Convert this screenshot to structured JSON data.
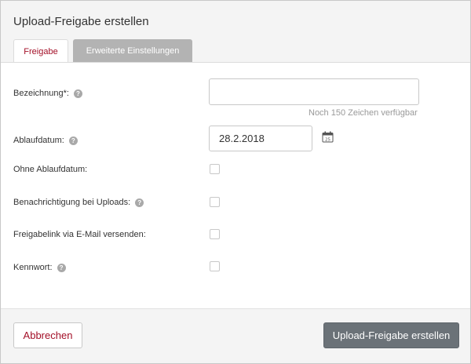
{
  "dialog": {
    "title": "Upload-Freigabe erstellen"
  },
  "tabs": [
    {
      "label": "Freigabe",
      "active": true
    },
    {
      "label": "Erweiterte Einstellungen",
      "active": false
    }
  ],
  "form": {
    "bezeichnung": {
      "label": "Bezeichnung*:",
      "value": "",
      "hint": "Noch 150 Zeichen verfügbar"
    },
    "ablaufdatum": {
      "label": "Ablaufdatum:",
      "value": "28.2.2018",
      "calendar_day": "25"
    },
    "ohne_ablaufdatum": {
      "label": "Ohne Ablaufdatum:",
      "checked": false
    },
    "benachrichtigung": {
      "label": "Benachrichtigung bei Uploads:",
      "checked": false
    },
    "email_versenden": {
      "label": "Freigabelink via E-Mail versenden:",
      "checked": false
    },
    "kennwort": {
      "label": "Kennwort:",
      "checked": false
    }
  },
  "help_icon_glyph": "?",
  "footer": {
    "cancel_label": "Abbrechen",
    "create_label": "Upload-Freigabe erstellen"
  },
  "colors": {
    "accent": "#a30f27",
    "primary_button": "#6b7278",
    "inactive_tab": "#b3b3b3"
  }
}
